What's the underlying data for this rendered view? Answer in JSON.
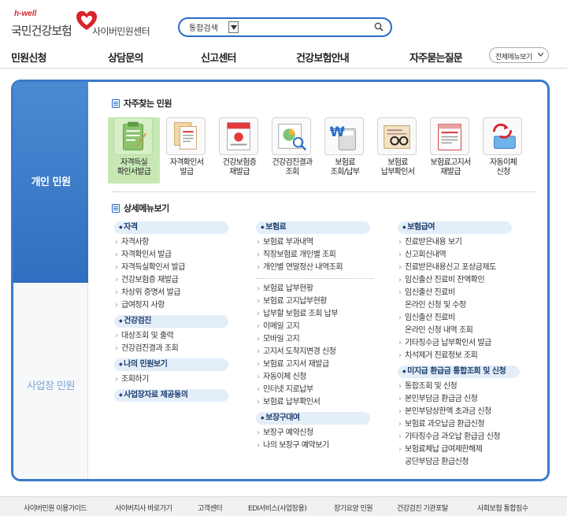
{
  "header": {
    "logo_small": "h-well",
    "logo_name": "국민건강보험",
    "logo_sub": "사이버민원센터",
    "search": {
      "scope": "통합검색",
      "value": "",
      "placeholder": ""
    }
  },
  "nav": {
    "items": [
      "민원신청",
      "상담문의",
      "신고센터",
      "건강보험안내",
      "자주묻는질문"
    ],
    "all_menu": "전체메뉴보기"
  },
  "side": {
    "personal": "개인 민원",
    "business": "사업장 민원"
  },
  "favorites": {
    "title": "자주찾는 민원",
    "items": [
      {
        "label": "자격득실\n확인서발급",
        "icon": "clipboard-icon",
        "selected": true
      },
      {
        "label": "자격확인서\n발급",
        "icon": "certificate-icon"
      },
      {
        "label": "건강보험증\n재발급",
        "icon": "insurance-card-icon"
      },
      {
        "label": "건강검진결과\n조회",
        "icon": "chart-magnifier-icon"
      },
      {
        "label": "보험료\n조회/납부",
        "icon": "won-calculator-icon"
      },
      {
        "label": "보험료\n납부확인서",
        "icon": "glasses-document-icon"
      },
      {
        "label": "보험료고지서\n재발급",
        "icon": "bill-icon"
      },
      {
        "label": "자동이체\n신청",
        "icon": "refresh-cards-icon"
      }
    ]
  },
  "detail": {
    "title": "상세메뉴보기",
    "col1": [
      {
        "cat": "자격",
        "items": [
          "자격사항",
          "자격확인서 발급",
          "자격득실확인서 발급",
          "건강보험증 재발급",
          "차상위 증명서 발급",
          "급여정지 사항"
        ]
      },
      {
        "cat": "건강검진",
        "items": [
          "대상조회 및 출력",
          "건강검진결과 조회"
        ]
      },
      {
        "cat": "나의 민원보기",
        "items": [
          "조회하기"
        ]
      },
      {
        "cat": "사업장자료 제공동의",
        "items": []
      }
    ],
    "col2": [
      {
        "cat": "보험료",
        "items": [
          "보험료 부과내역",
          "직장보험료 개인별 조회",
          "개인별 연말정산 내역조회"
        ],
        "items2": [
          "보험료 납부현황",
          "보험료 고지납부현황",
          "납부할 보험료 조회 납부",
          "이메일 고지",
          "모바일 고지",
          "고지서 도착지변경 신청",
          "보험료 고지서 재발급",
          "자동이체 신청",
          "인터넷 지로납부",
          "보험료 납부확인서"
        ]
      },
      {
        "cat": "보장구대여",
        "items": [
          "보장구 예약신청",
          "나의 보장구 예약보기"
        ]
      }
    ],
    "col3": [
      {
        "cat": "보험급여",
        "items": [
          "진료받은내용 보기",
          "신고회신내역",
          "진료받은내용신고 포상금제도",
          "임신출산 진료비 잔액확인",
          "임신출산 진료비\n온라인 신청 및 수정",
          "임신출산 진료비\n온라인 신청 내역 조회",
          "기타징수금 납부확인서 발급",
          "치석제거 진료정보 조회"
        ]
      },
      {
        "cat": "미지급 환급금 통합조회 및 신청",
        "items": [
          "통합조회 및 신청",
          "본인부담금 환급금 신청",
          "본인부담상한액 초과금 신청",
          "보험료 과오납금 환급신청",
          "기타징수금 과오납 환급금 신청",
          "보험료체납 급여제한해제\n공단부담금 환급신청"
        ]
      }
    ]
  },
  "footer": [
    "사이버민원 이용가이드",
    "사이버지사 바로가기",
    "고객센터",
    "EDI서비스(사업장용)",
    "장기요양 민원",
    "건강검진 기관포탈",
    "사회보험 통합징수"
  ]
}
